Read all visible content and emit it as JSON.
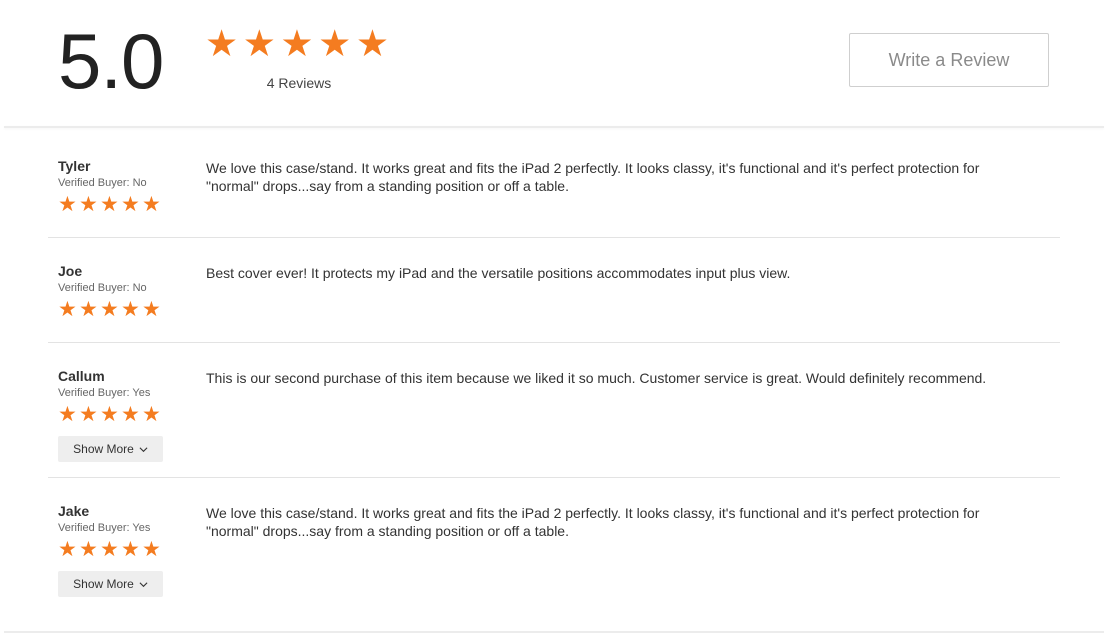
{
  "summary": {
    "score": "5.0",
    "rating": 5,
    "review_count": "4 Reviews",
    "write_review_label": "Write a Review"
  },
  "colors": {
    "star": "#f47c20",
    "divider": "#e3e3e3",
    "button_bg": "#eeeeee"
  },
  "reviews": [
    {
      "name": "Tyler",
      "verified": "Verified Buyer: No",
      "rating": 5,
      "text": "We love this case/stand. It works great and fits the iPad 2 perfectly. It looks classy, it's functional and it's perfect protection for \"normal\" drops...say from a standing position or off a table."
    },
    {
      "name": "Joe",
      "verified": "Verified Buyer: No",
      "rating": 5,
      "text": "Best cover ever! It protects my iPad and the versatile positions accommodates input plus view."
    },
    {
      "name": "Callum",
      "verified": "Verified Buyer: Yes",
      "rating": 5,
      "text": "This is our second purchase of this item because we liked it so much. Customer service is great. Would definitely recommend.",
      "show_more_label": "Show More"
    },
    {
      "name": "Jake",
      "verified": "Verified Buyer: Yes",
      "rating": 5,
      "text": "We love this case/stand. It works great and fits the iPad 2 perfectly. It looks classy, it's functional and it's perfect protection for \"normal\" drops...say from a standing position or off a table.",
      "show_more_label": "Show More"
    }
  ]
}
